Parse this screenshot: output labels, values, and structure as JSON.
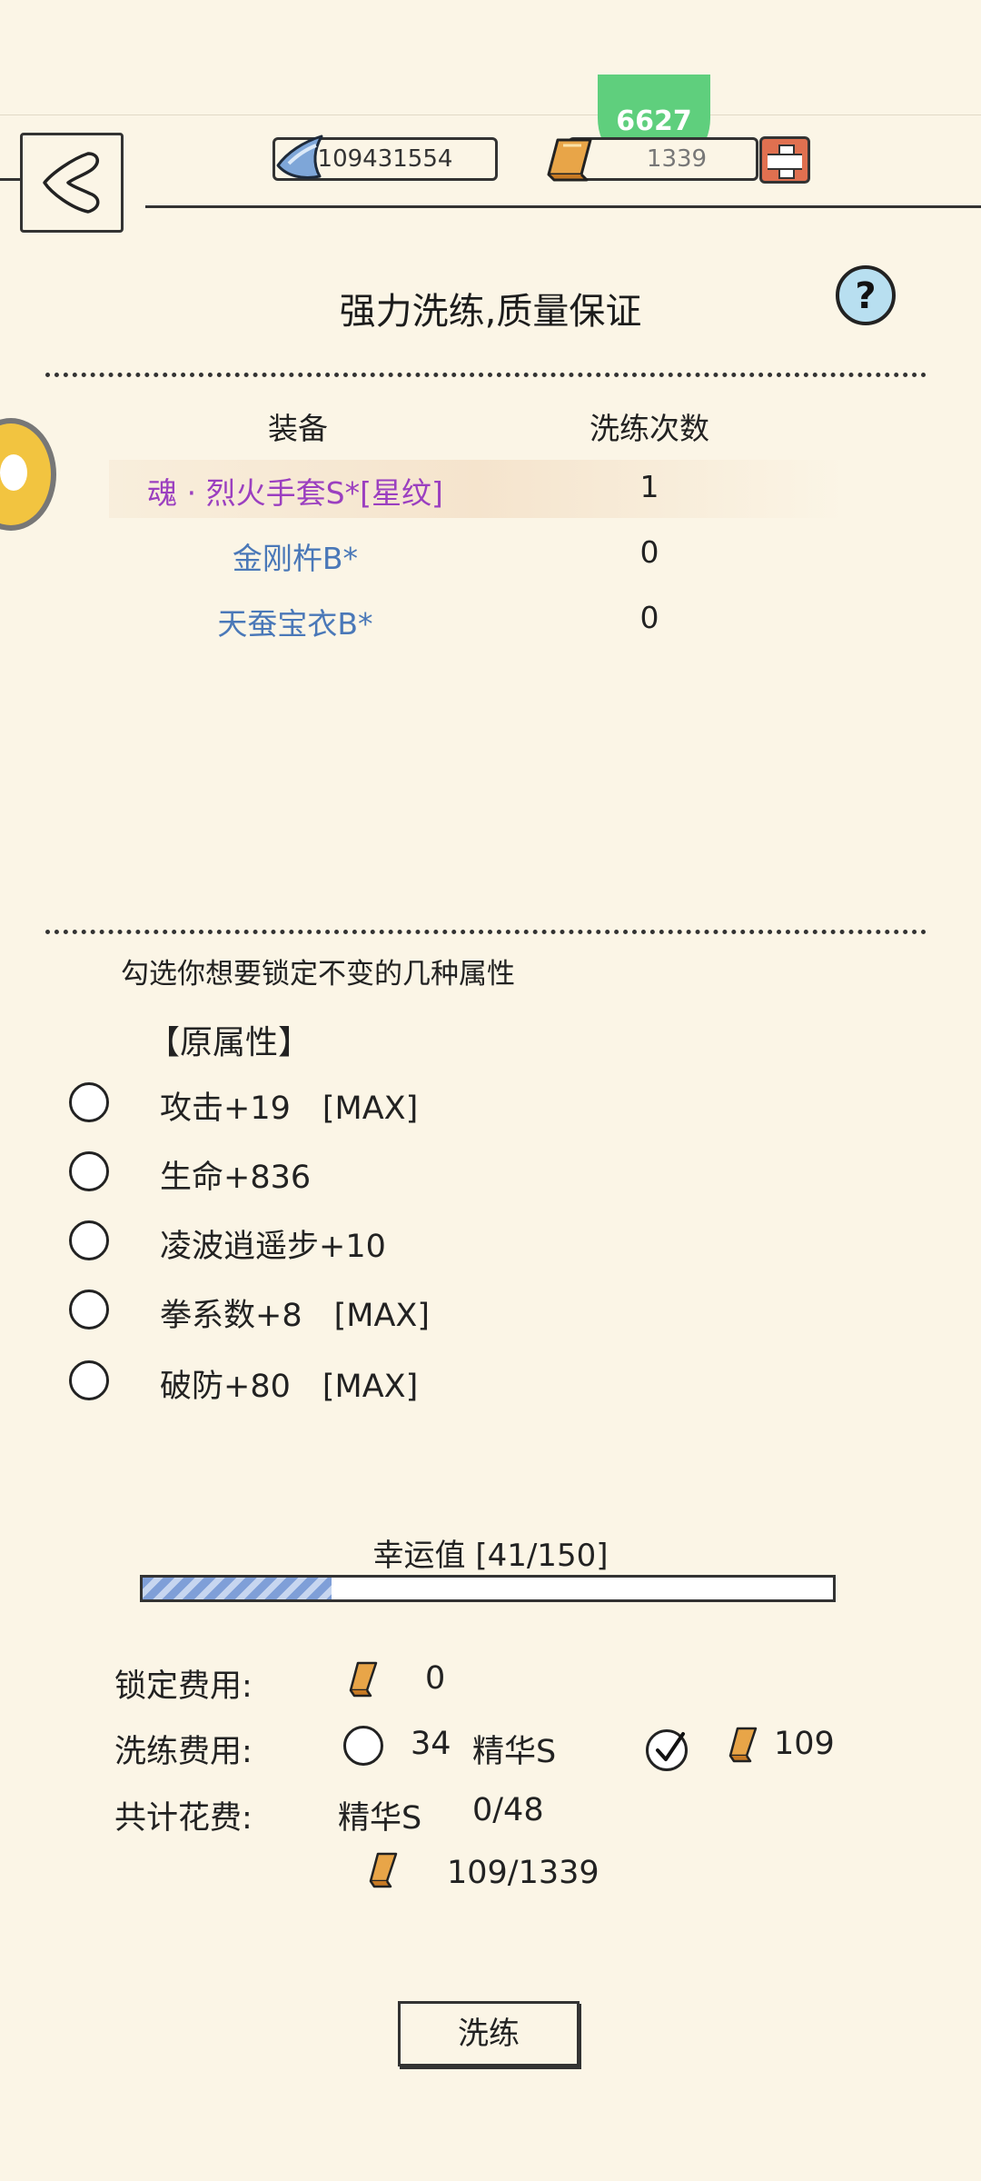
{
  "top_bar": {
    "currency_1_value": "109431554",
    "currency_2_value": "1339",
    "badge_value": "6627"
  },
  "title": "强力洗练,质量保证",
  "help_label": "?",
  "table": {
    "headers": {
      "equipment": "装备",
      "count": "洗练次数"
    },
    "rows": [
      {
        "name": "魂 · 烈火手套S*[星纹]",
        "count": "1",
        "color": "#9b3fc0"
      },
      {
        "name": "金刚杵B*",
        "count": "0",
        "color": "#4a78b8"
      },
      {
        "name": "天蚕宝衣B*",
        "count": "0",
        "color": "#4a78b8"
      }
    ]
  },
  "lock": {
    "hint": "勾选你想要锁定不变的几种属性",
    "section_title": "【原属性】",
    "attributes": [
      {
        "label": "攻击+19　[MAX]"
      },
      {
        "label": "生命+836"
      },
      {
        "label": "凌波逍遥步+10"
      },
      {
        "label": "拳系数+8　[MAX]"
      },
      {
        "label": "破防+80　[MAX]"
      }
    ]
  },
  "luck": {
    "label": "幸运值 [41/150]",
    "current": 41,
    "max": 150
  },
  "costs": {
    "lock_label": "锁定费用:",
    "lock_value": "0",
    "refine_label": "洗练费用:",
    "option_essence_amount": "34",
    "option_essence_name": "精华S",
    "option_gold_amount": "109",
    "total_label": "共计花费:",
    "total_essence_name": "精华S",
    "total_essence_value": "0/48",
    "total_gold_value": "109/1339"
  },
  "refine_button": "洗练",
  "colors": {
    "background": "#fbf5e6",
    "purple_item": "#9b3fc0",
    "blue_item": "#4a78b8",
    "gold": "#e8a548",
    "luck_bar": "#7f9fd8"
  }
}
